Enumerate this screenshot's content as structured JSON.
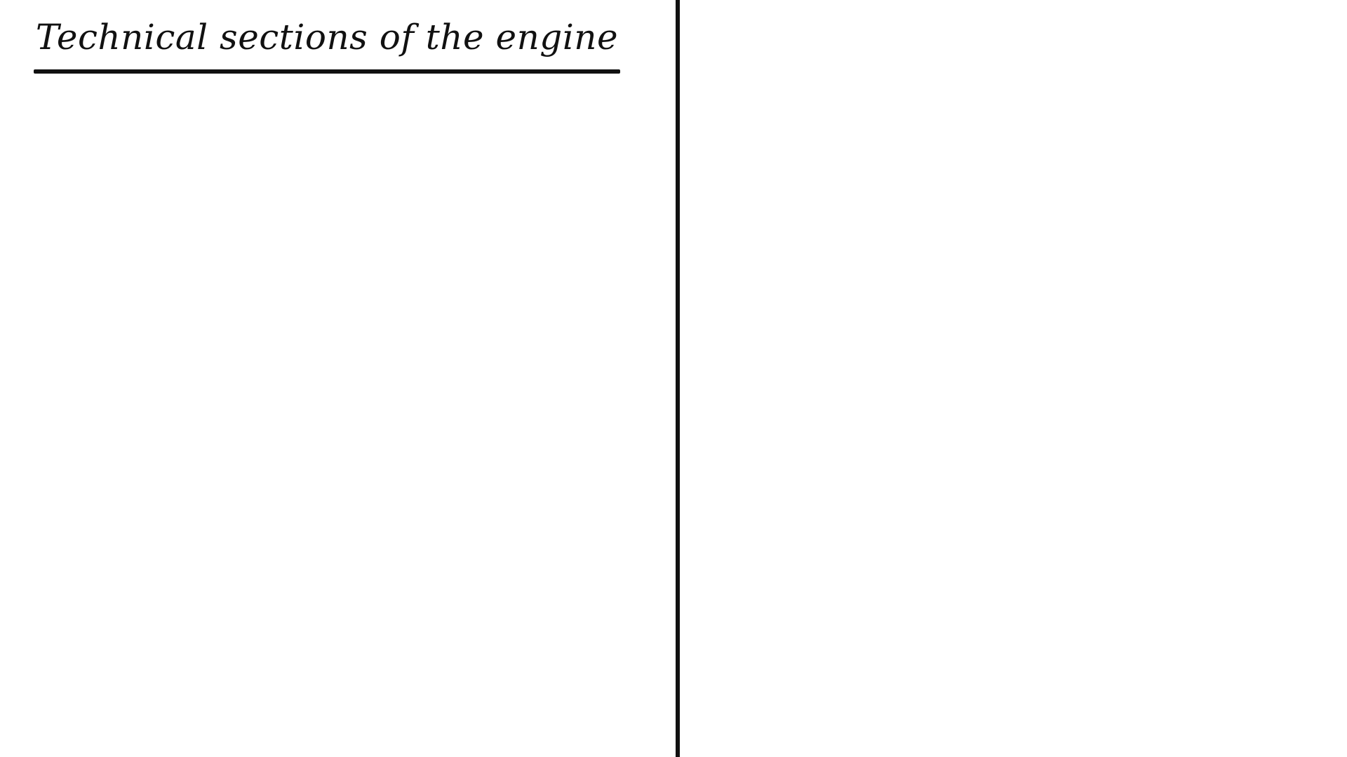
{
  "diagram": {
    "title": "Technical sections of the engine"
  },
  "colors": {
    "ink": "#111111",
    "background": "#ffffff"
  }
}
